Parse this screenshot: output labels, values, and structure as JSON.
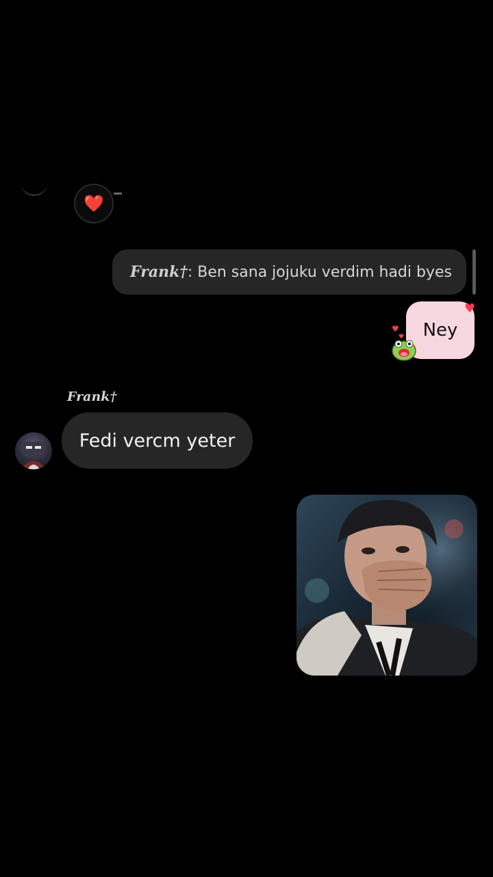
{
  "reaction": {
    "emoji": "❤️"
  },
  "reply_preview": {
    "author": "Frank†",
    "separator": ":",
    "text": " Ben sana jojuku verdim hadi byes"
  },
  "sent_message": {
    "text": "Ney"
  },
  "received": {
    "sender": "Frank†",
    "text": "Fedi vercm yeter"
  },
  "colors": {
    "background": "#000000",
    "bubble_dark": "#262626",
    "bubble_pink": "#f7d7e0"
  },
  "icons": [
    "heart-reaction-icon",
    "frog-sticker-icon",
    "avatar",
    "photo-message"
  ]
}
